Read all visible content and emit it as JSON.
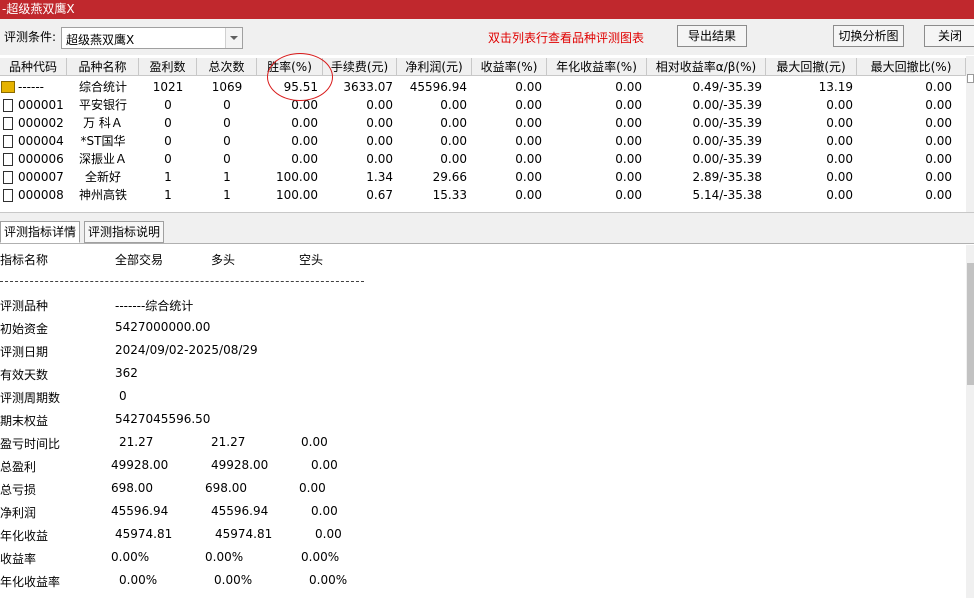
{
  "window": {
    "title": "-超级燕双鹰X"
  },
  "toolbar": {
    "condition_label": "评测条件:",
    "condition_value": "超级燕双鹰X",
    "hint": "双击列表行查看品种评测图表",
    "export_label": "导出结果",
    "switch_label": "切换分析图",
    "close_label": "关闭"
  },
  "table": {
    "columns": [
      "品种代码",
      "品种名称",
      "盈利数",
      "总次数",
      "胜率(%)",
      "手续费(元)",
      "净利润(元)",
      "收益率(%)",
      "年化收益率(%)",
      "相对收益率α/β(%)",
      "最大回撤(元)",
      "最大回撤比(%)"
    ],
    "rows": [
      {
        "icon": "folder-icon",
        "code": "------",
        "name": "综合统计",
        "wins": "1021",
        "total": "1069",
        "winrate": "95.51",
        "fee": "3633.07",
        "profit": "45596.94",
        "ret": "0.00",
        "annual": "0.00",
        "alpha": "0.49/-35.39",
        "dd": "13.19",
        "ddr": "0.00"
      },
      {
        "icon": "doc-icon",
        "code": "000001",
        "name": "平安银行",
        "wins": "0",
        "total": "0",
        "winrate": "0.00",
        "fee": "0.00",
        "profit": "0.00",
        "ret": "0.00",
        "annual": "0.00",
        "alpha": "0.00/-35.39",
        "dd": "0.00",
        "ddr": "0.00"
      },
      {
        "icon": "doc-icon",
        "code": "000002",
        "name": "万 科Ａ",
        "wins": "0",
        "total": "0",
        "winrate": "0.00",
        "fee": "0.00",
        "profit": "0.00",
        "ret": "0.00",
        "annual": "0.00",
        "alpha": "0.00/-35.39",
        "dd": "0.00",
        "ddr": "0.00"
      },
      {
        "icon": "doc-icon",
        "code": "000004",
        "name": "*ST国华",
        "wins": "0",
        "total": "0",
        "winrate": "0.00",
        "fee": "0.00",
        "profit": "0.00",
        "ret": "0.00",
        "annual": "0.00",
        "alpha": "0.00/-35.39",
        "dd": "0.00",
        "ddr": "0.00"
      },
      {
        "icon": "doc-icon",
        "code": "000006",
        "name": "深振业Ａ",
        "wins": "0",
        "total": "0",
        "winrate": "0.00",
        "fee": "0.00",
        "profit": "0.00",
        "ret": "0.00",
        "annual": "0.00",
        "alpha": "0.00/-35.39",
        "dd": "0.00",
        "ddr": "0.00"
      },
      {
        "icon": "doc-icon",
        "code": "000007",
        "name": "全新好",
        "wins": "1",
        "total": "1",
        "winrate": "100.00",
        "fee": "1.34",
        "profit": "29.66",
        "ret": "0.00",
        "annual": "0.00",
        "alpha": "2.89/-35.38",
        "dd": "0.00",
        "ddr": "0.00"
      },
      {
        "icon": "doc-icon",
        "code": "000008",
        "name": "神州高铁",
        "wins": "1",
        "total": "1",
        "winrate": "100.00",
        "fee": "0.67",
        "profit": "15.33",
        "ret": "0.00",
        "annual": "0.00",
        "alpha": "5.14/-35.38",
        "dd": "0.00",
        "ddr": "0.00"
      }
    ]
  },
  "tabs": [
    "评测指标详情",
    "评测指标说明"
  ],
  "detail": {
    "headers": [
      "指标名称",
      "全部交易",
      "多头",
      "空头"
    ],
    "rows": [
      {
        "label": "评测品种",
        "v1": "-------综合统计",
        "v2": "",
        "v3": ""
      },
      {
        "label": "初始资金",
        "v1": "5427000000.00",
        "v2": "",
        "v3": ""
      },
      {
        "label": "评测日期",
        "v1": "2024/09/02-2025/08/29",
        "v2": "",
        "v3": ""
      },
      {
        "label": "有效天数",
        "v1": "362",
        "v2": "",
        "v3": ""
      },
      {
        "label": "评测周期数",
        "v1": "0",
        "v2": "",
        "v3": ""
      },
      {
        "label": "期末权益",
        "v1": "5427045596.50",
        "v2": "",
        "v3": ""
      },
      {
        "label": "盈亏时间比",
        "v1": "21.27",
        "v2": "21.27",
        "v3": "0.00"
      },
      {
        "label": "总盈利",
        "v1": "49928.00",
        "v2": "49928.00",
        "v3": "0.00"
      },
      {
        "label": "总亏损",
        "v1": "698.00",
        "v2": "698.00",
        "v3": "0.00"
      },
      {
        "label": "净利润",
        "v1": "45596.94",
        "v2": "45596.94",
        "v3": "0.00"
      },
      {
        "label": "年化收益",
        "v1": "45974.81",
        "v2": "45974.81",
        "v3": "0.00"
      },
      {
        "label": "收益率",
        "v1": "0.00%",
        "v2": "0.00%",
        "v3": "0.00%"
      },
      {
        "label": "年化收益率",
        "v1": "0.00%",
        "v2": "0.00%",
        "v3": "0.00%"
      }
    ]
  },
  "colors": {
    "titlebar": "#c0282d",
    "hint": "#e00000",
    "highlight_circle": "#d81a1a"
  }
}
